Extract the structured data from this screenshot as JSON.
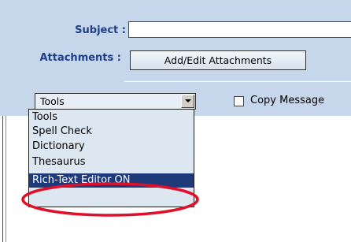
{
  "form": {
    "subject_label": "Subject :",
    "subject_value": "",
    "attachments_label": "Attachments :",
    "attach_button_label": "Add/Edit Attachments"
  },
  "tools_select": {
    "selected": "Tools",
    "options": [
      "Tools",
      "Spell Check",
      "Dictionary",
      "Thesaurus",
      "Rich-Text Editor ON"
    ],
    "highlighted_option": "Rich-Text Editor ON"
  },
  "copy_message": {
    "label": "Copy Message",
    "checked": false
  },
  "colors": {
    "panel_bg": "#c6d7eb",
    "label_text": "#1f3f86",
    "selection_bg": "#1e3a7a",
    "highlight_ellipse": "#e0102a"
  },
  "icons": {
    "dropdown_arrow": "chevron-down-icon"
  }
}
